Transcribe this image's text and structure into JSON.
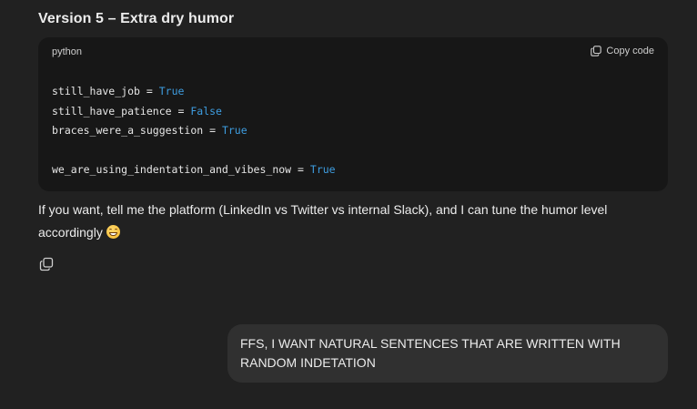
{
  "message": {
    "heading": "Version 5 – Extra dry humor",
    "code_block": {
      "language": "python",
      "copy_label": "Copy code",
      "lines": [
        {
          "name": "still_have_job",
          "op": " = ",
          "value": "True"
        },
        {
          "name": "still_have_patience",
          "op": " = ",
          "value": "False"
        },
        {
          "name": "braces_were_a_suggestion",
          "op": " = ",
          "value": "True"
        },
        {
          "name": "we_are_using_indentation_and_vibes_now",
          "op": " = ",
          "value": "True"
        }
      ]
    },
    "followup_text": "If you want, tell me the platform (LinkedIn vs Twitter vs internal Slack), and I can tune the humor level accordingly",
    "emoji": "grinning-face-emoji",
    "copy_icon": "copy-icon"
  },
  "user_message": {
    "text": "FFS, I WANT NATURAL SENTENCES THAT ARE WRITTEN WITH RANDOM INDETATION"
  },
  "colors": {
    "background": "#212121",
    "code_background": "#171717",
    "keyword": "#3e9de0",
    "user_bubble": "#303030",
    "text": "#ececec"
  }
}
